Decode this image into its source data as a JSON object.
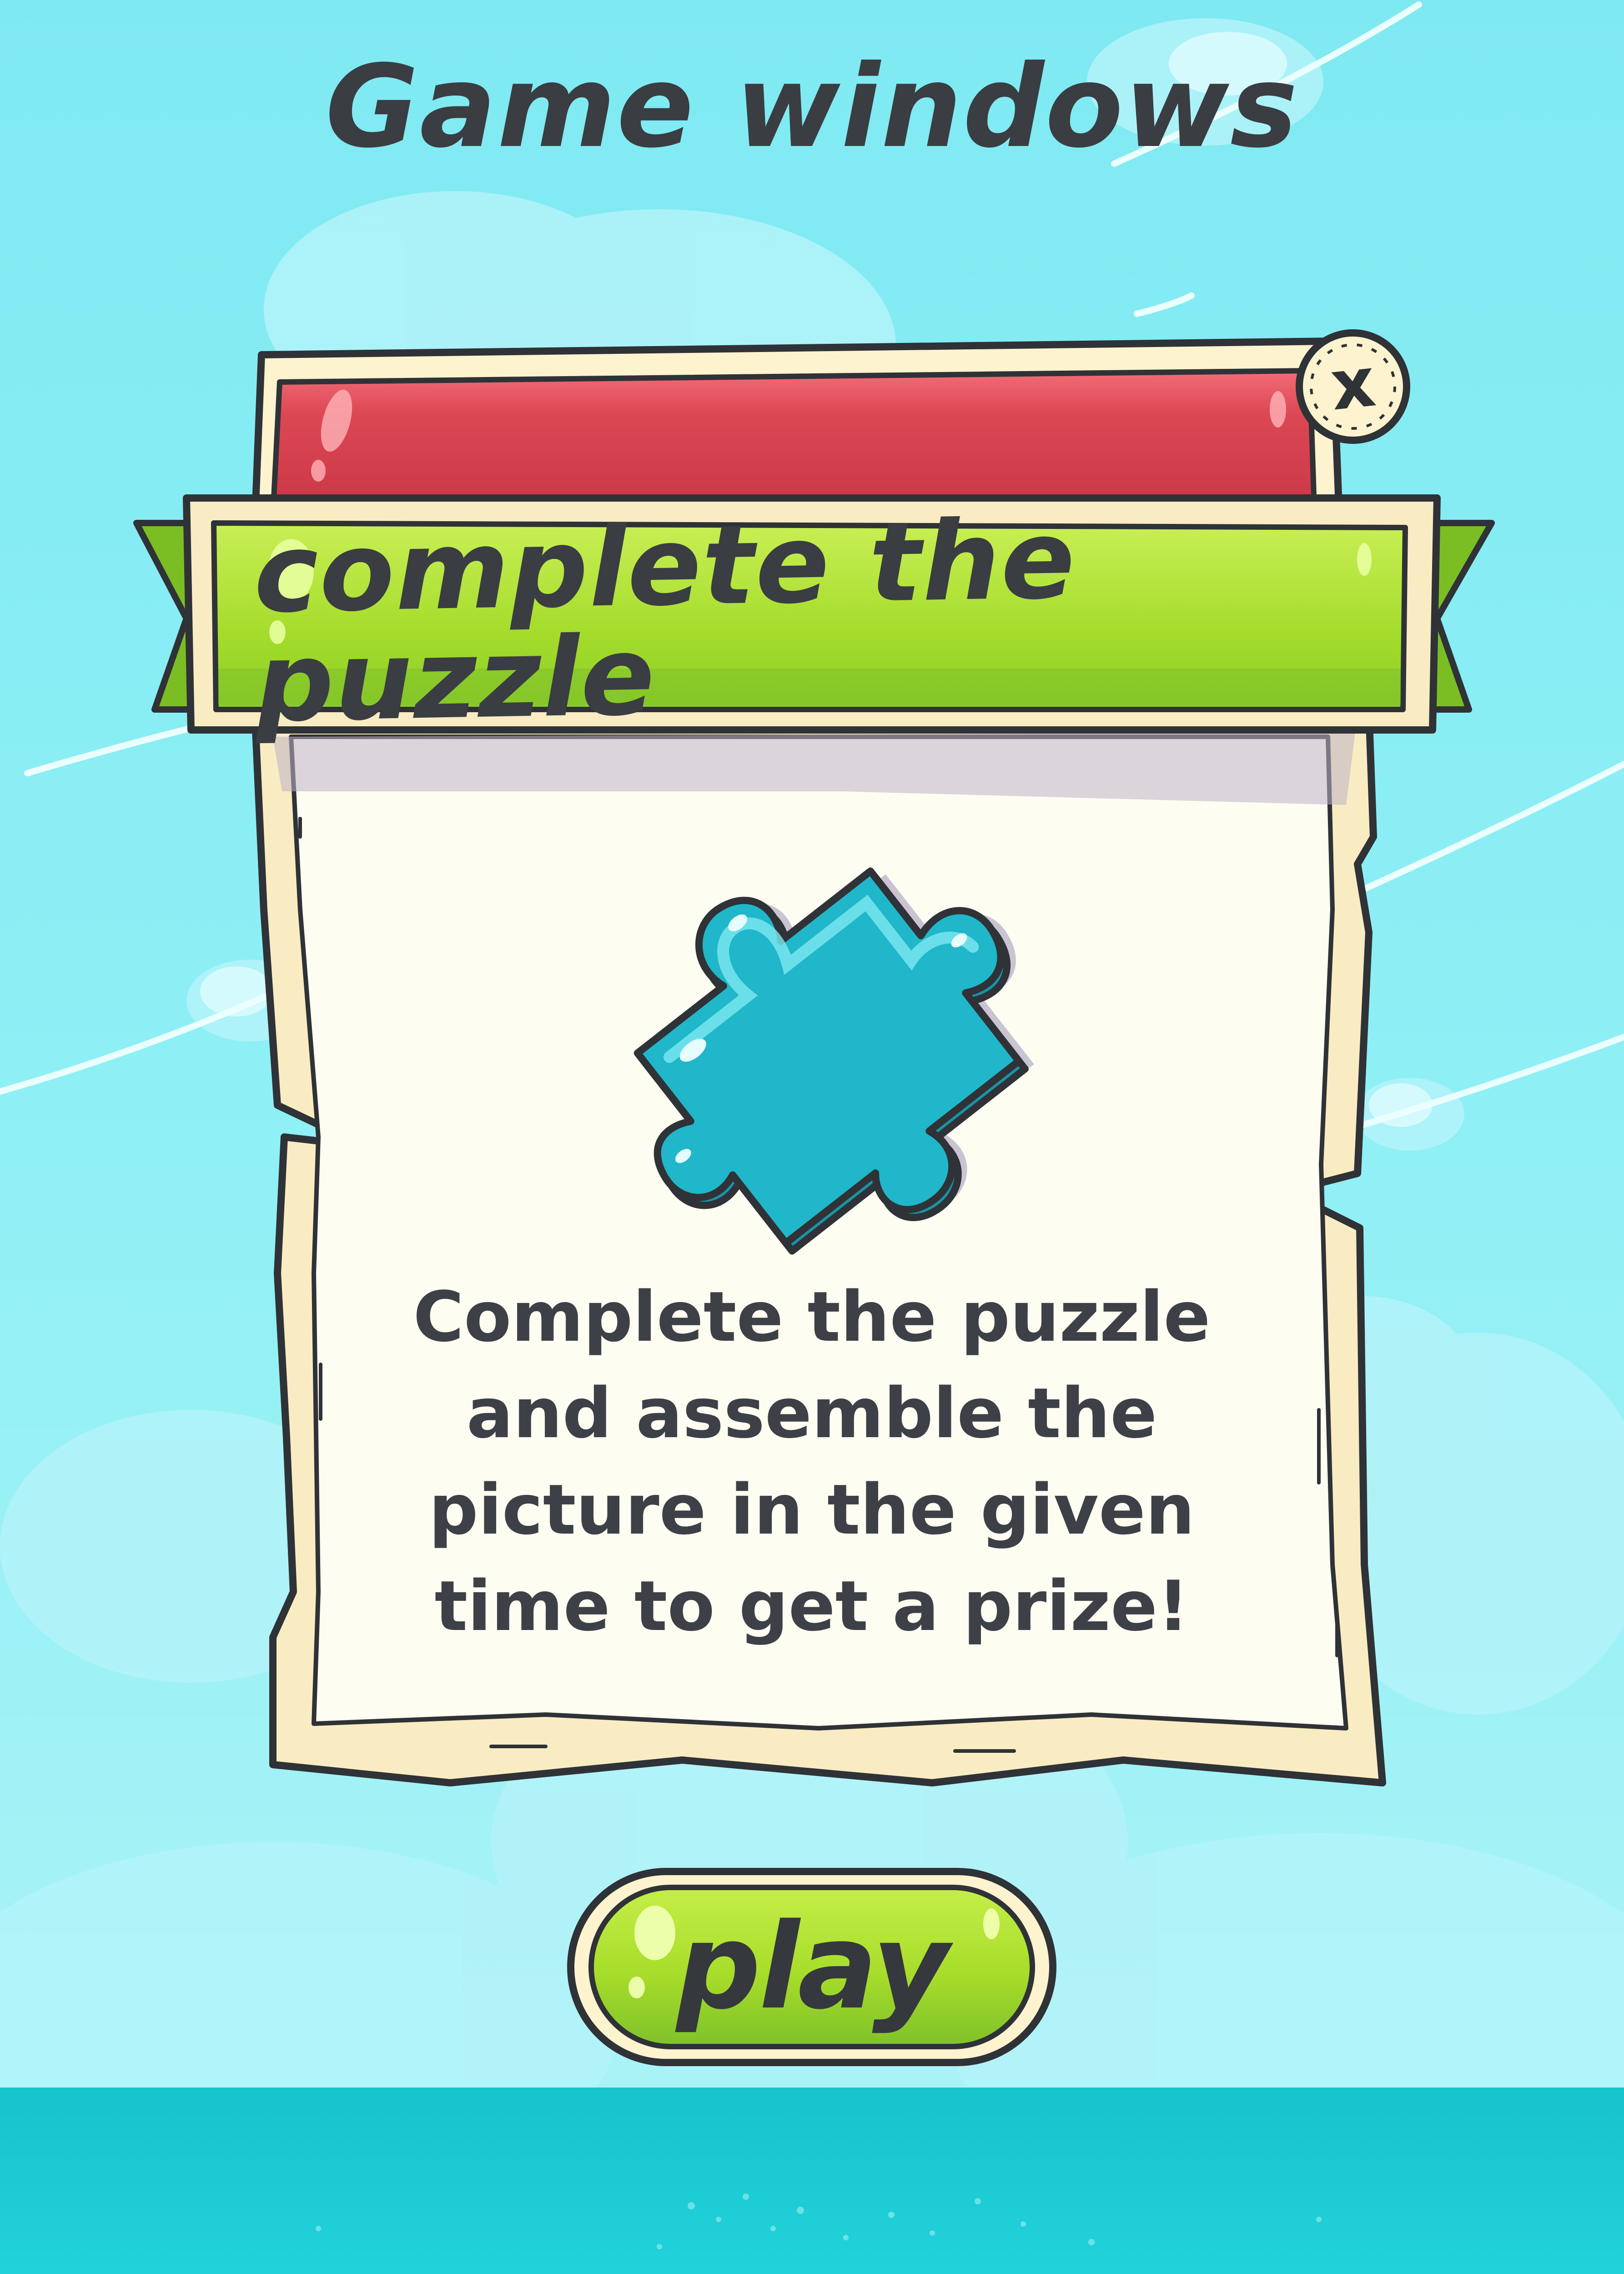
{
  "page": {
    "title": "Game windows"
  },
  "window": {
    "banner_title": "complete the puzzle",
    "close_label": "x",
    "description": "Complete the puzzle and assemble the picture in the given time to get a prize!",
    "icon": "puzzle-piece-icon"
  },
  "actions": {
    "play_label": "play"
  },
  "colors": {
    "sky": "#8ff0f5",
    "sky_top": "#7fe9f2",
    "cloud": "#b6f4fa",
    "sea": "#1ecbd3",
    "header_red": "#d8424f",
    "ribbon_green": "#a6de2c",
    "ribbon_dark": "#5fa51f",
    "parchment": "#fefdf2",
    "parchment_edge": "#f7e9bd",
    "puzzle_blue": "#1fb7c9",
    "outline": "#2f3236",
    "text": "#3d4046"
  }
}
